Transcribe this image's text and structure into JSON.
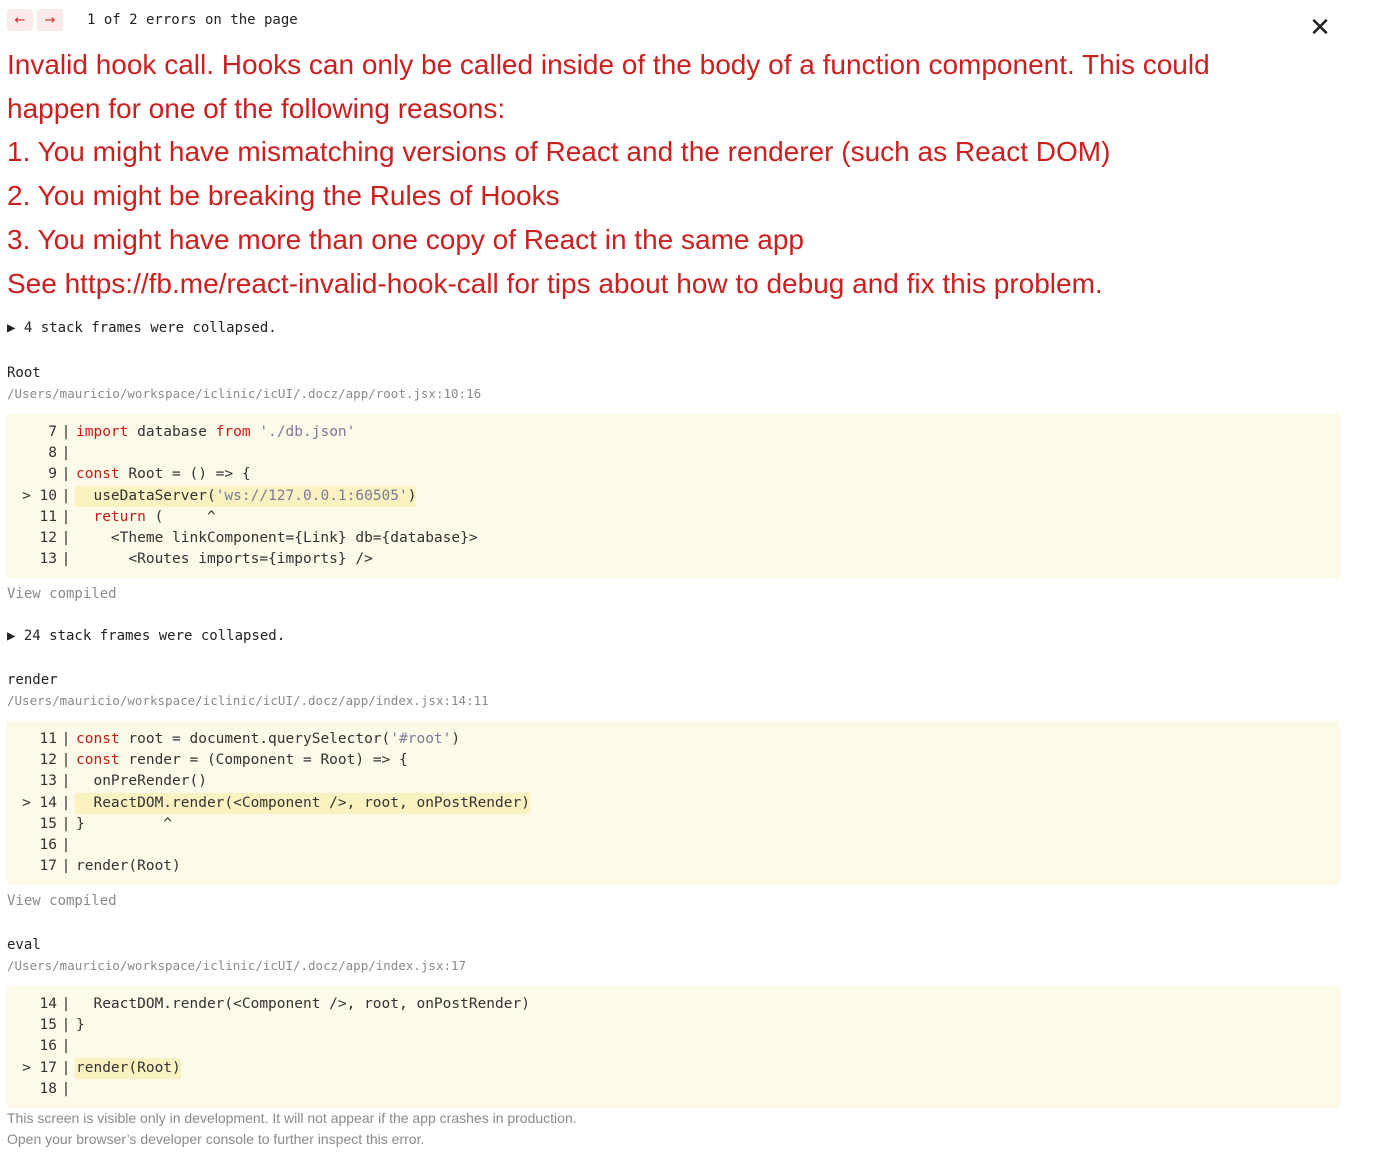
{
  "nav": {
    "prev_icon": "←",
    "next_icon": "→",
    "error_count": "1 of 2 errors on the page"
  },
  "close_icon": "✕",
  "headline": {
    "line1": "Invalid hook call. Hooks can only be called inside of the body of a function component. This could happen for one of the following reasons:",
    "reason1": "1. You might have mismatching versions of React and the renderer (such as React DOM)",
    "reason2": "2. You might be breaking the Rules of Hooks",
    "reason3": "3. You might have more than one copy of React in the same app",
    "see_more": "See https://fb.me/react-invalid-hook-call for tips about how to debug and fix this problem."
  },
  "collapsed1": "▶ 4 stack frames were collapsed.",
  "frames": [
    {
      "name": "Root",
      "path": "/Users/mauricio/workspace/iclinic/icUI/.docz/app/root.jsx:10:16",
      "view_compiled": "View compiled",
      "lines": [
        {
          "num": "   7",
          "code": "import database from './db.json'",
          "hl": false
        },
        {
          "num": "   8",
          "code": "",
          "hl": false
        },
        {
          "num": "   9",
          "code": "const Root = () => {",
          "hl": false
        },
        {
          "num": "> 10",
          "code": "  useDataServer('ws://127.0.0.1:60505')",
          "hl": true
        },
        {
          "num": "  11",
          "code": "  return (     ^",
          "hl": false
        },
        {
          "num": "  12",
          "code": "    <Theme linkComponent={Link} db={database}>",
          "hl": false
        },
        {
          "num": "  13",
          "code": "      <Routes imports={imports} />",
          "hl": false
        }
      ]
    },
    {
      "name": "render",
      "path": "/Users/mauricio/workspace/iclinic/icUI/.docz/app/index.jsx:14:11",
      "view_compiled": "View compiled",
      "lines": [
        {
          "num": "  11",
          "code": "const root = document.querySelector('#root')",
          "hl": false
        },
        {
          "num": "  12",
          "code": "const render = (Component = Root) => {",
          "hl": false
        },
        {
          "num": "  13",
          "code": "  onPreRender()",
          "hl": false
        },
        {
          "num": "> 14",
          "code": "  ReactDOM.render(<Component />, root, onPostRender)",
          "hl": true
        },
        {
          "num": "  15",
          "code": "}         ^",
          "hl": false
        },
        {
          "num": "  16",
          "code": "",
          "hl": false
        },
        {
          "num": "  17",
          "code": "render(Root)",
          "hl": false
        }
      ]
    },
    {
      "name": "eval",
      "path": "/Users/mauricio/workspace/iclinic/icUI/.docz/app/index.jsx:17",
      "lines": [
        {
          "num": "  14",
          "code": "  ReactDOM.render(<Component />, root, onPostRender)",
          "hl": false
        },
        {
          "num": "  15",
          "code": "}",
          "hl": false
        },
        {
          "num": "  16",
          "code": "",
          "hl": false
        },
        {
          "num": "> 17",
          "code": "render(Root)",
          "hl": true
        },
        {
          "num": "  18",
          "code": "",
          "hl": false
        }
      ]
    }
  ],
  "collapsed2": "▶ 24 stack frames were collapsed.",
  "footer": {
    "line1": "This screen is visible only in development. It will not appear if the app crashes in production.",
    "line2": "Open your browser’s developer console to further inspect this error."
  }
}
